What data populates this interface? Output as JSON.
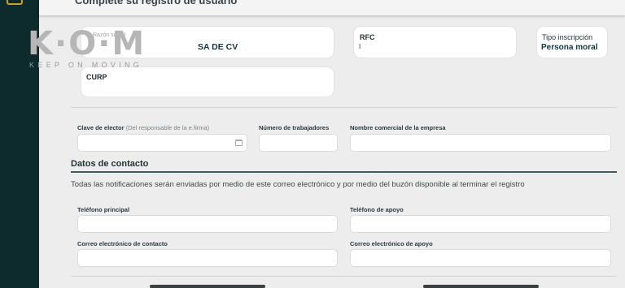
{
  "logo": {
    "word": "K·O·M",
    "tagline": "KEEP ON MOVING"
  },
  "header": {
    "title": "Complete su registro de usuario"
  },
  "top_cards": {
    "razon_social": {
      "label": "Razón social",
      "value": "SA DE CV"
    },
    "rfc": {
      "label": "RFC",
      "value": "I"
    },
    "tipo_inscripcion": {
      "label": "Tipo inscripción",
      "value": "Persona moral"
    },
    "curp": {
      "label": "CURP",
      "value": ""
    }
  },
  "fields": {
    "clave_elector": {
      "label": "Clave de elector",
      "hint": "(Del responsable de la e.firma)",
      "value": ""
    },
    "numero_trabajadores": {
      "label": "Número de trabajadores",
      "value": ""
    },
    "nombre_comercial": {
      "label": "Nombre comercial de la empresa",
      "value": ""
    }
  },
  "contacto": {
    "title": "Datos de contacto",
    "notice": "Todas las notificaciones serán enviadas por medio de este correo electrónico y por medio del buzón disponible al terminar el registro",
    "telefono_principal": {
      "label": "Teléfono principal",
      "value": ""
    },
    "telefono_apoyo": {
      "label": "Teléfono de apoyo",
      "value": ""
    },
    "correo_contacto": {
      "label": "Correo electrónico de contacto",
      "value": ""
    },
    "correo_apoyo": {
      "label": "Correo electrónico de apoyo",
      "value": ""
    }
  },
  "colors": {
    "sidebar": "#0d2a2d",
    "accent": "#3f5a60",
    "logo_red": "#e04236"
  }
}
